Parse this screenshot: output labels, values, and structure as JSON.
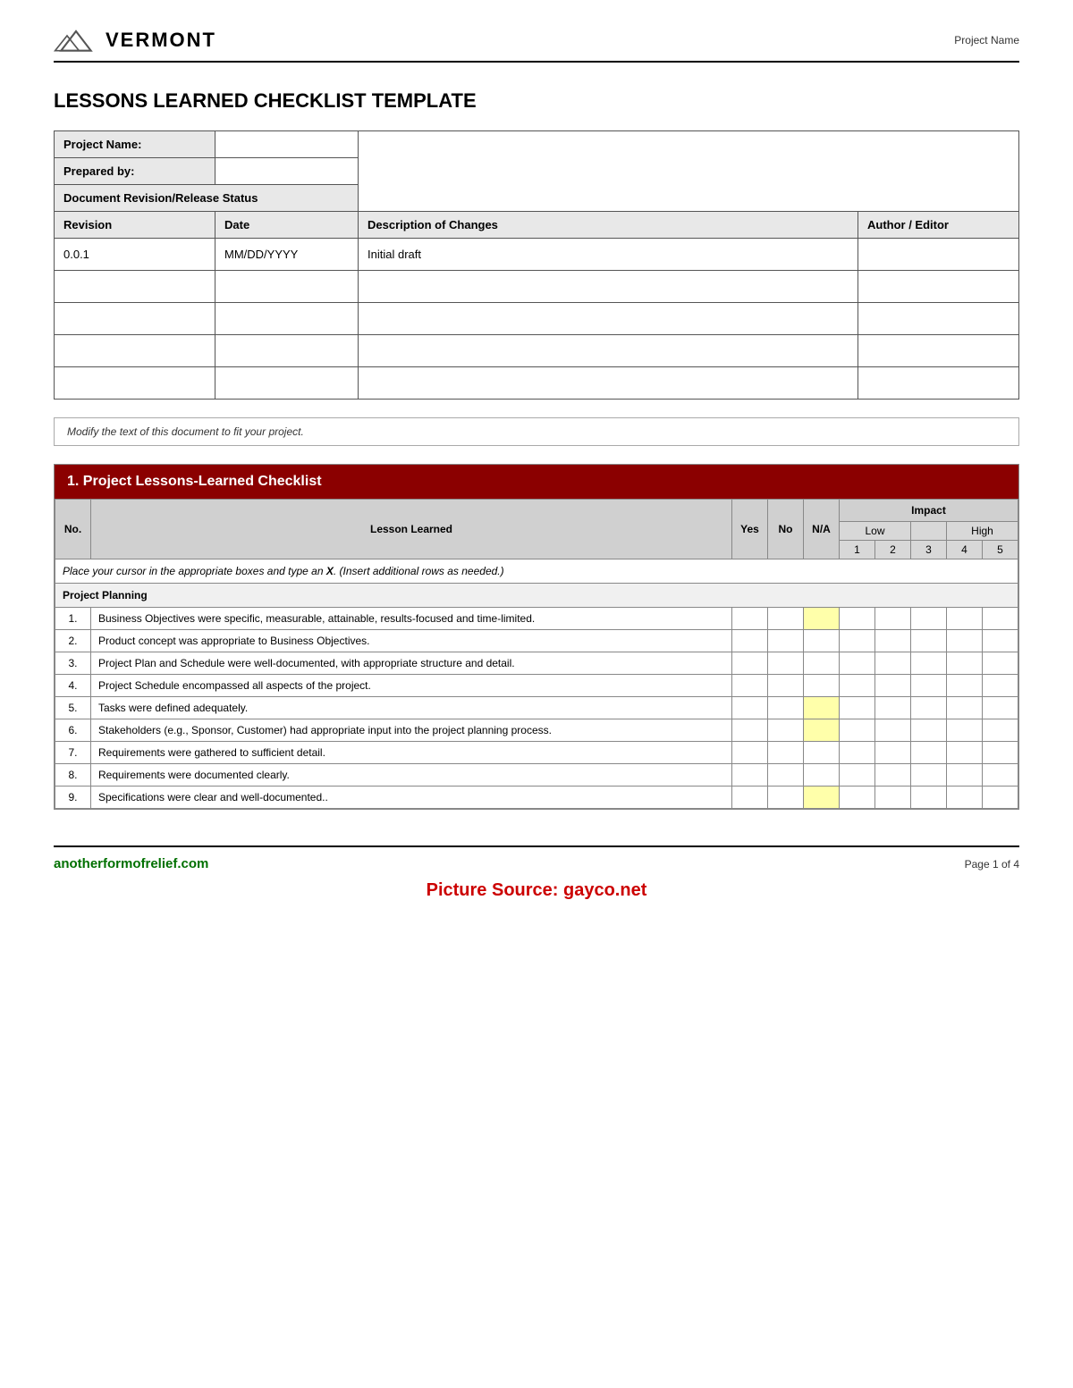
{
  "header": {
    "logo_text": "VERMONT",
    "project_name_label": "Project Name"
  },
  "title": "LESSONS LEARNED CHECKLIST TEMPLATE",
  "info_fields": {
    "project_name_label": "Project Name:",
    "prepared_by_label": "Prepared by:",
    "revision_status_label": "Document Revision/Release Status"
  },
  "revision_table": {
    "headers": [
      "Revision",
      "Date",
      "Description of Changes",
      "Author / Editor"
    ],
    "rows": [
      {
        "revision": "0.0.1",
        "date": "MM/DD/YYYY",
        "description": "Initial draft",
        "author": ""
      },
      {
        "revision": "",
        "date": "",
        "description": "",
        "author": ""
      },
      {
        "revision": "",
        "date": "",
        "description": "",
        "author": ""
      },
      {
        "revision": "",
        "date": "",
        "description": "",
        "author": ""
      },
      {
        "revision": "",
        "date": "",
        "description": "",
        "author": ""
      }
    ]
  },
  "notice": "Modify the text of this document to fit your project.",
  "checklist": {
    "section_title": "1.  Project Lessons-Learned Checklist",
    "col_no": "No",
    "col_lesson": "Lesson Learned",
    "col_yes": "Yes",
    "col_na": "N/A",
    "col_impact": "Impact",
    "col_low": "Low",
    "col_high": "High",
    "impact_levels": [
      "1",
      "2",
      "3",
      "4",
      "5"
    ],
    "instruction": "Place your cursor in the appropriate boxes and type an X. (Insert additional rows as needed.)",
    "categories": [
      {
        "name": "Project Planning",
        "items": [
          {
            "no": "1.",
            "text": "Business Objectives were specific, measurable, attainable, results-focused and time-limited.",
            "na_highlight": true
          },
          {
            "no": "2.",
            "text": "Product concept was appropriate to Business Objectives.",
            "na_highlight": false
          },
          {
            "no": "3.",
            "text": "Project Plan and Schedule were well-documented, with appropriate structure and detail.",
            "na_highlight": false
          },
          {
            "no": "4.",
            "text": "Project Schedule encompassed all aspects of the project.",
            "na_highlight": false
          },
          {
            "no": "5.",
            "text": "Tasks were defined adequately.",
            "na_highlight": true
          },
          {
            "no": "6.",
            "text": "Stakeholders (e.g., Sponsor, Customer) had appropriate input into the project planning process.",
            "na_highlight": true
          },
          {
            "no": "7.",
            "text": "Requirements were gathered to sufficient detail.",
            "na_highlight": false
          },
          {
            "no": "8.",
            "text": "Requirements were documented clearly.",
            "na_highlight": false
          },
          {
            "no": "9.",
            "text": "Specifications were clear and well-documented..",
            "na_highlight": true
          }
        ]
      }
    ]
  },
  "footer": {
    "link": "anotherformofrelief.com",
    "page_label": "Page 1 of 4"
  },
  "picture_source": "Picture Source: gayco.net"
}
